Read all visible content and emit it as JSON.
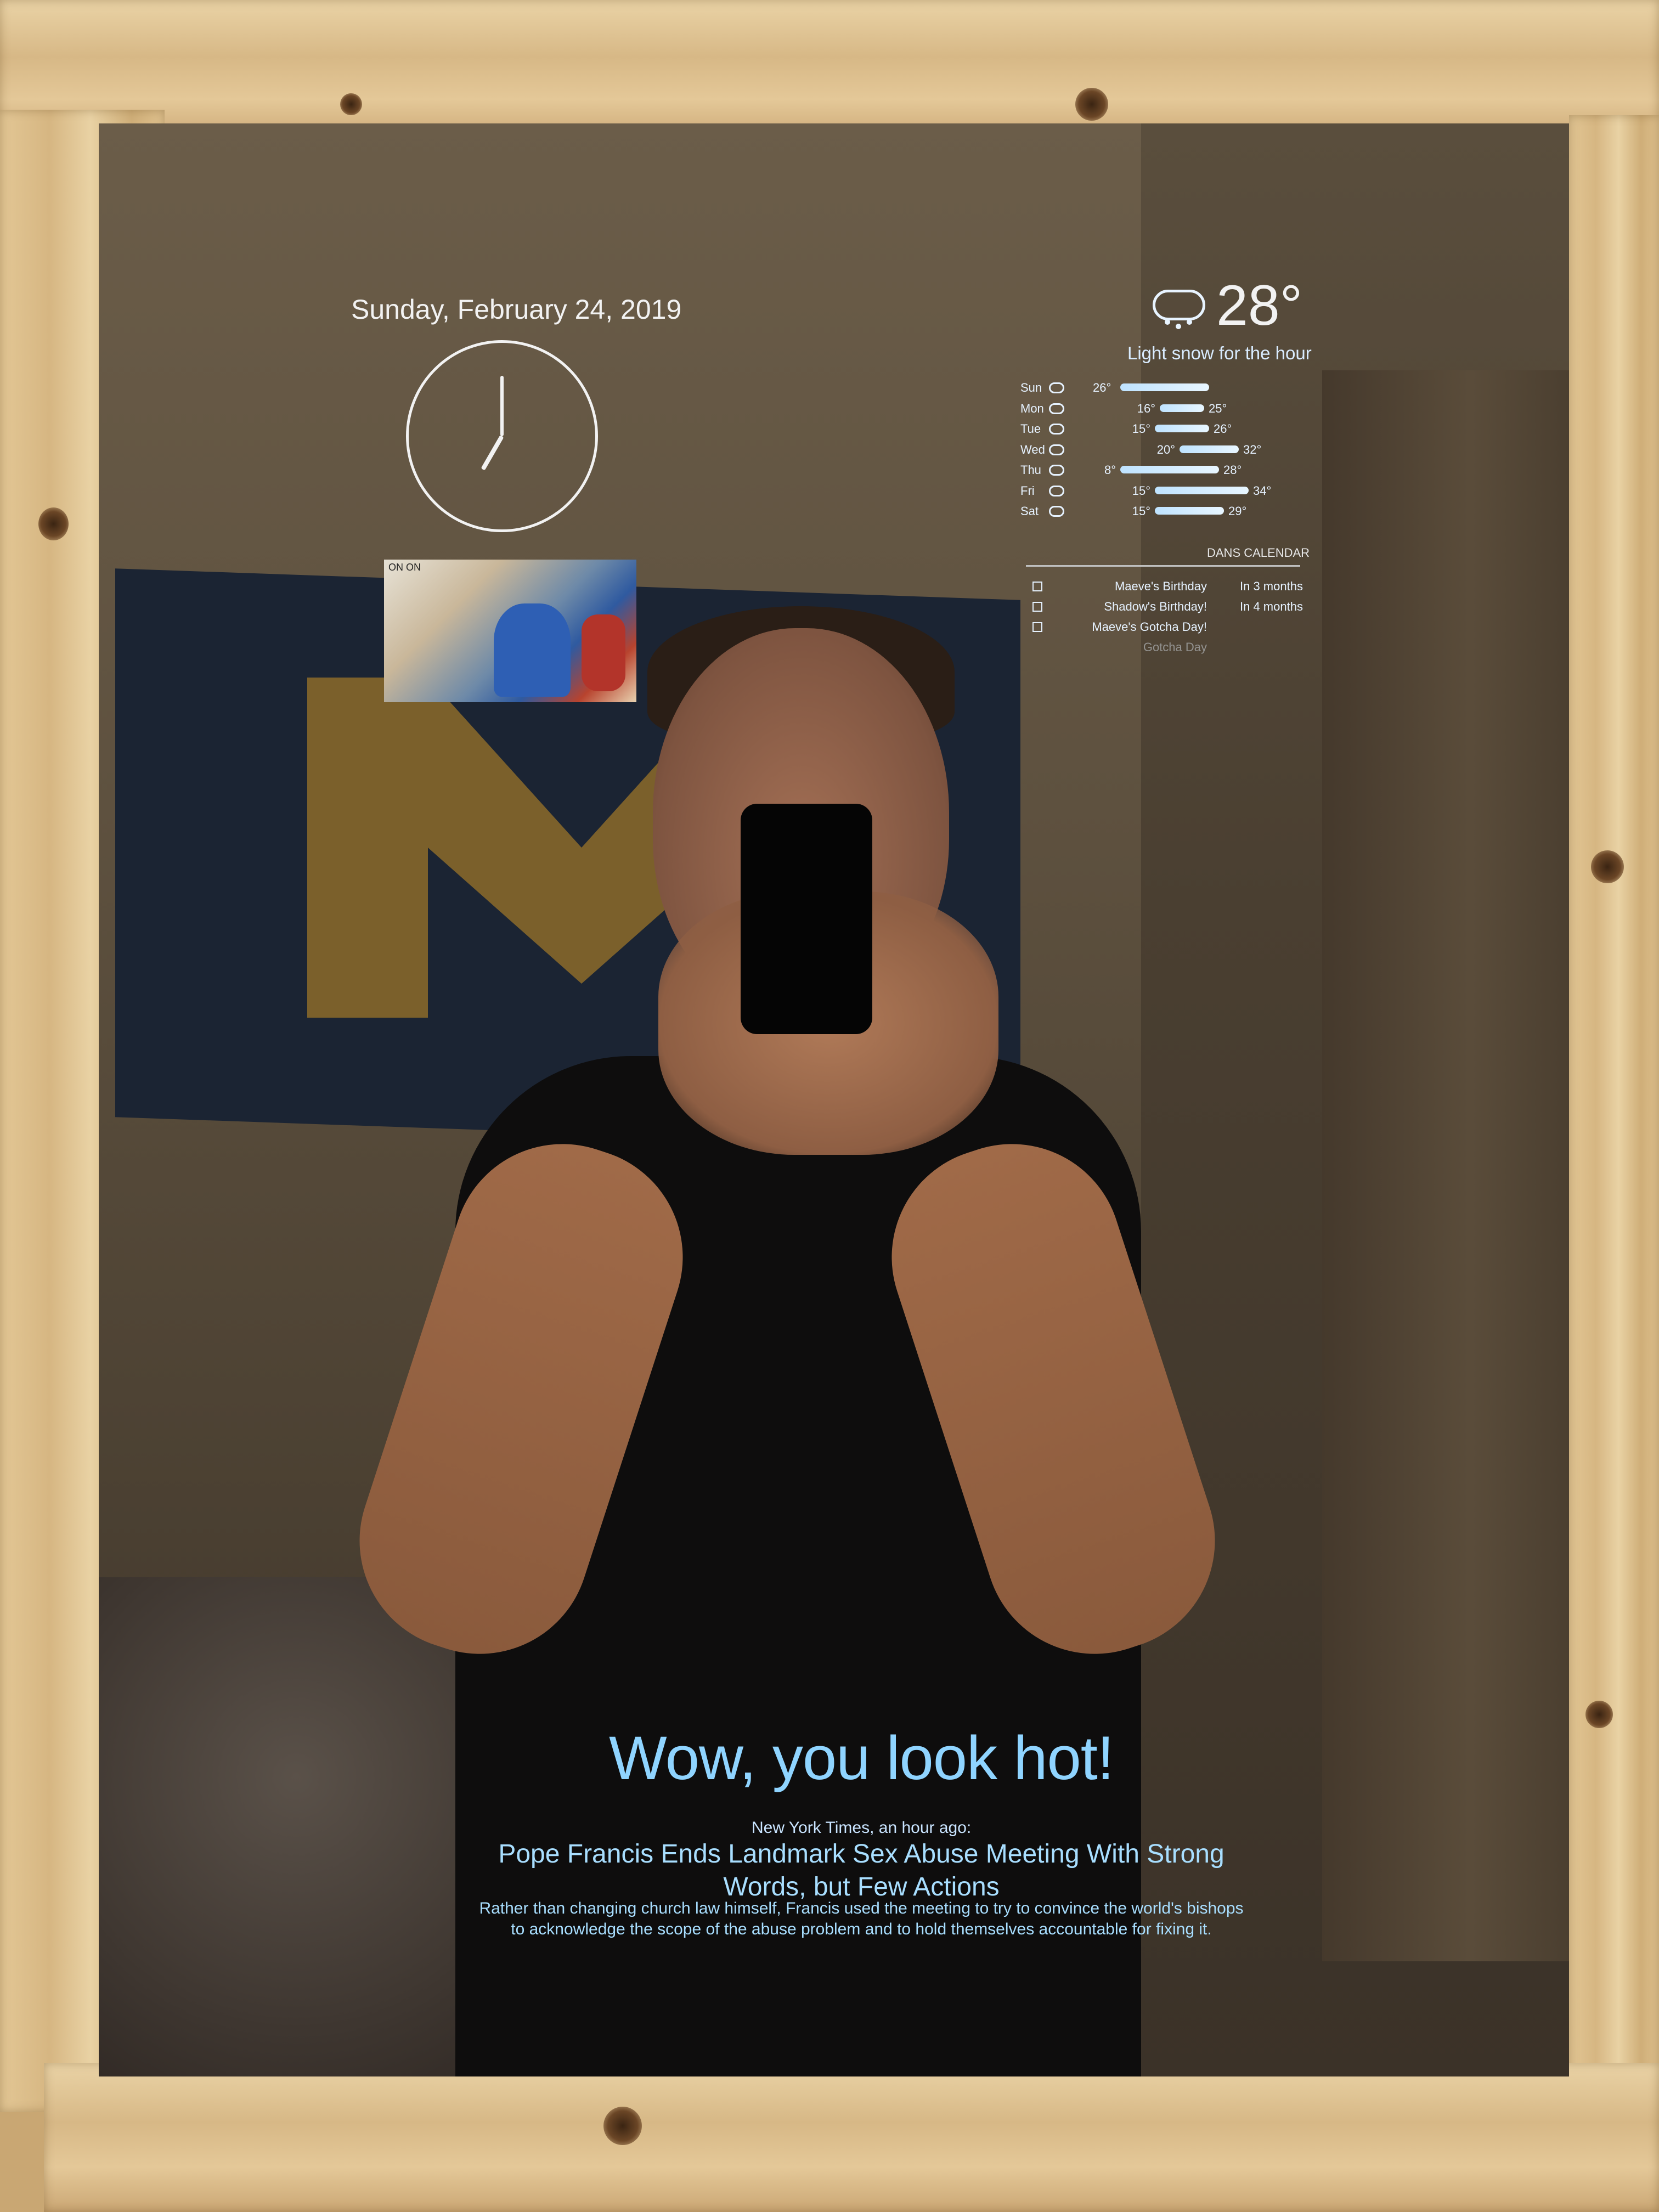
{
  "date": "Sunday, February 24, 2019",
  "clock": {
    "hour": 7,
    "minute": 0
  },
  "news_image": {
    "tag": "ON ON"
  },
  "weather": {
    "icon": "snow-cloud-icon",
    "current_temp": "28°",
    "summary": "Light snow for the hour",
    "forecast": [
      {
        "day": "Sun",
        "icon": "cloud-icon",
        "low": "",
        "high": "26°"
      },
      {
        "day": "Mon",
        "icon": "cloud-icon",
        "low": "16°",
        "high": "25°"
      },
      {
        "day": "Tue",
        "icon": "cloud-icon",
        "low": "15°",
        "high": "26°"
      },
      {
        "day": "Wed",
        "icon": "cloud-icon",
        "low": "20°",
        "high": "32°"
      },
      {
        "day": "Thu",
        "icon": "partly-cloudy-icon",
        "low": "8°",
        "high": "28°"
      },
      {
        "day": "Fri",
        "icon": "partly-cloudy-icon",
        "low": "15°",
        "high": "34°"
      },
      {
        "day": "Sat",
        "icon": "cloud-icon",
        "low": "15°",
        "high": "29°"
      }
    ]
  },
  "calendar": {
    "title": "DANS CALENDAR",
    "events": [
      {
        "name": "Maeve's Birthday",
        "time": "In 3 months"
      },
      {
        "name": "Shadow's Birthday!",
        "time": "In 4 months"
      },
      {
        "name": "Maeve's Gotcha Day!",
        "time": ""
      },
      {
        "name": "Gotcha Day",
        "time": ""
      }
    ]
  },
  "compliment": "Wow, you look hot!",
  "news": {
    "source": "New York Times, an hour ago:",
    "headline": "Pope Francis Ends Landmark Sex Abuse Meeting With Strong Words, but Few Actions",
    "description": "Rather than changing church law himself, Francis used the meeting to try to convince the world's bishops to acknowledge the scope of the abuse problem and to hold themselves accountable for fixing it."
  }
}
